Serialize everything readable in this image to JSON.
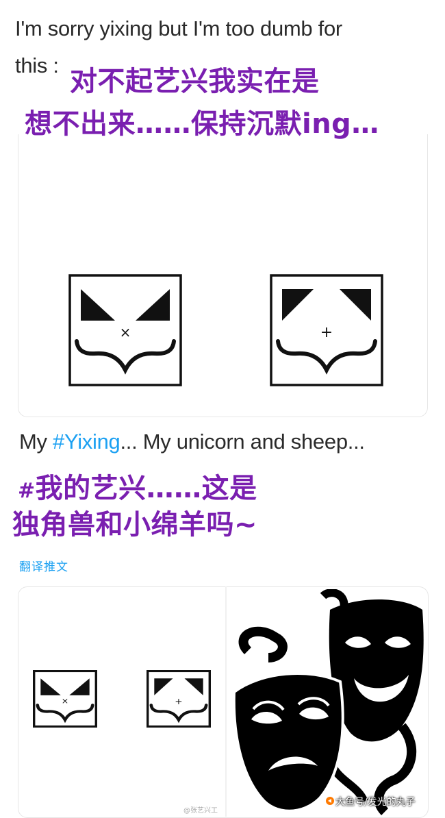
{
  "tweet1": {
    "text_line1": "I'm sorry yixing but I'm too dumb for",
    "text_line2": "this :",
    "caption_cn_line1": "对不起艺兴我实在是",
    "caption_cn_line2": "想不出来……保持沉默ing…"
  },
  "tweet2": {
    "text_prefix": "My ",
    "hashtag": "#Yixing",
    "text_suffix": "... My unicorn and sheep...",
    "caption_cn_hash": "#",
    "caption_cn_line1": "我的艺兴……这是",
    "caption_cn_line2": "独角兽和小绵羊吗~",
    "translate_label": "翻译推文"
  },
  "logos": {
    "left_mark": "×",
    "right_mark": "+"
  },
  "watermarks": {
    "main": "大鱼号/发光的丸子",
    "small": "@张艺兴工"
  },
  "colors": {
    "caption_purple": "#7a1fb0",
    "hashtag_blue": "#1da1f2",
    "text": "#2a2a2a"
  },
  "icons": {
    "left_logo": "unicorn-face-logo",
    "right_logo": "sheep-face-logo",
    "masks": "theater-masks-icon",
    "watermark": "fish-logo-icon"
  }
}
